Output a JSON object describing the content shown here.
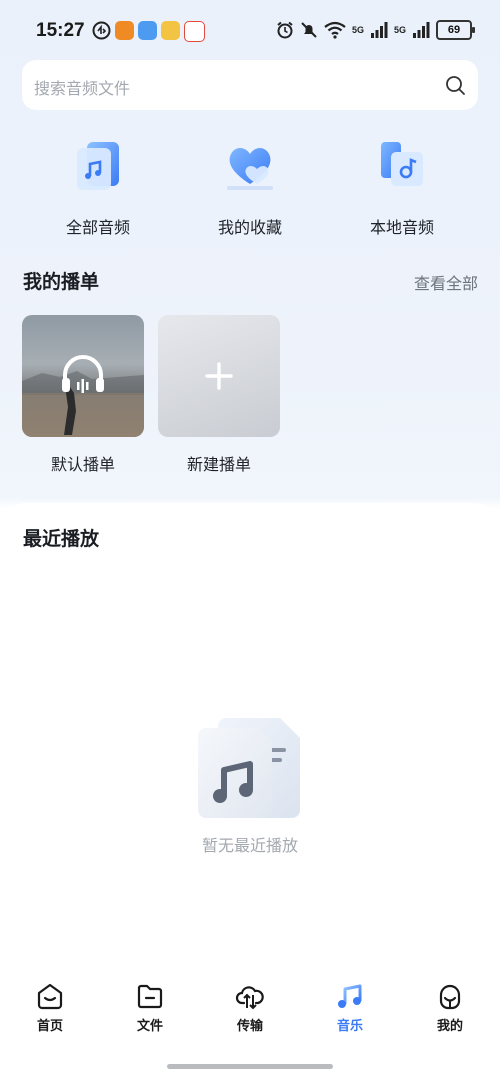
{
  "status_bar": {
    "time": "15:27",
    "battery": "69",
    "network_labels": [
      "5G",
      "5G"
    ]
  },
  "search": {
    "placeholder": "搜索音频文件"
  },
  "quick_entries": [
    {
      "label": "全部音频",
      "icon": "audio-file-icon"
    },
    {
      "label": "我的收藏",
      "icon": "heart-icon"
    },
    {
      "label": "本地音频",
      "icon": "phone-music-icon"
    }
  ],
  "playlists_section": {
    "title": "我的播单",
    "view_all": "查看全部",
    "items": [
      {
        "label": "默认播单",
        "icon": "headphones-icon"
      },
      {
        "label": "新建播单",
        "icon": "plus-icon"
      }
    ]
  },
  "recent": {
    "title": "最近播放",
    "empty_text": "暂无最近播放"
  },
  "bottom_nav": [
    {
      "label": "首页",
      "icon": "home-icon",
      "active": false
    },
    {
      "label": "文件",
      "icon": "folder-icon",
      "active": false
    },
    {
      "label": "传输",
      "icon": "transfer-cloud-icon",
      "active": false
    },
    {
      "label": "音乐",
      "icon": "music-note-icon",
      "active": true
    },
    {
      "label": "我的",
      "icon": "profile-icon",
      "active": false
    }
  ],
  "colors": {
    "accent": "#3b7bf5",
    "muted_text": "#a4a9b0"
  }
}
